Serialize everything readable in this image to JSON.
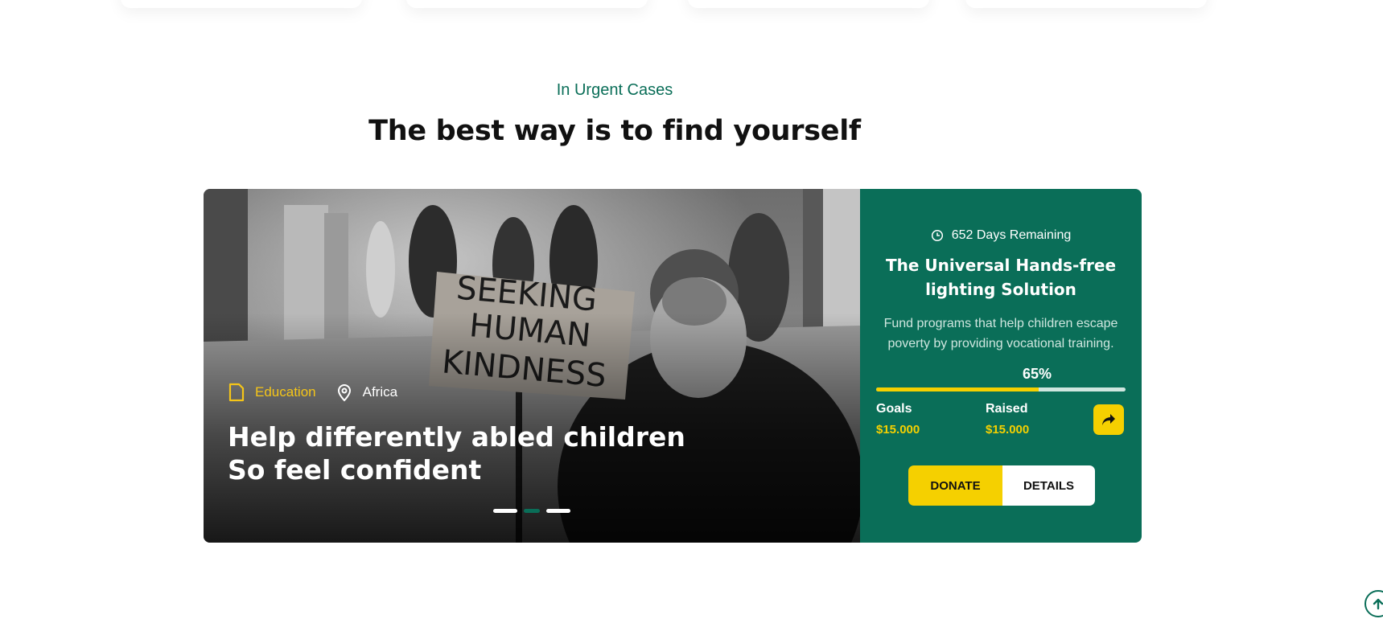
{
  "section": {
    "subtitle": "In Urgent Cases",
    "title": "The best way is to find yourself"
  },
  "campaign": {
    "category": "Education",
    "location": "Africa",
    "title_line1": "Help differently abled children",
    "title_line2": "So feel confident",
    "slides": {
      "count": 3,
      "active": 2
    },
    "photo_sign_text": [
      "SEEKING",
      "HUMAN",
      "KINDNESS"
    ]
  },
  "panel": {
    "remaining": "652 Days Remaining",
    "title": "The Universal Hands-free lighting Solution",
    "description": "Fund programs that help children escape poverty by providing vocational training.",
    "progress_label": "65%",
    "progress": 0.65,
    "goals_label": "Goals",
    "goals_value": "$15.000",
    "raised_label": "Raised",
    "raised_value": "$15.000",
    "donate_label": "DONATE",
    "details_label": "DETAILS"
  },
  "colors": {
    "brand_green": "#0a6e58",
    "accent_yellow": "#f5d000",
    "category_yellow": "#f5c518"
  },
  "icons": {
    "category": "document-icon",
    "location": "map-pin-icon",
    "remaining": "clock-icon",
    "share": "share-arrow-icon",
    "to_top": "arrow-up-icon"
  }
}
